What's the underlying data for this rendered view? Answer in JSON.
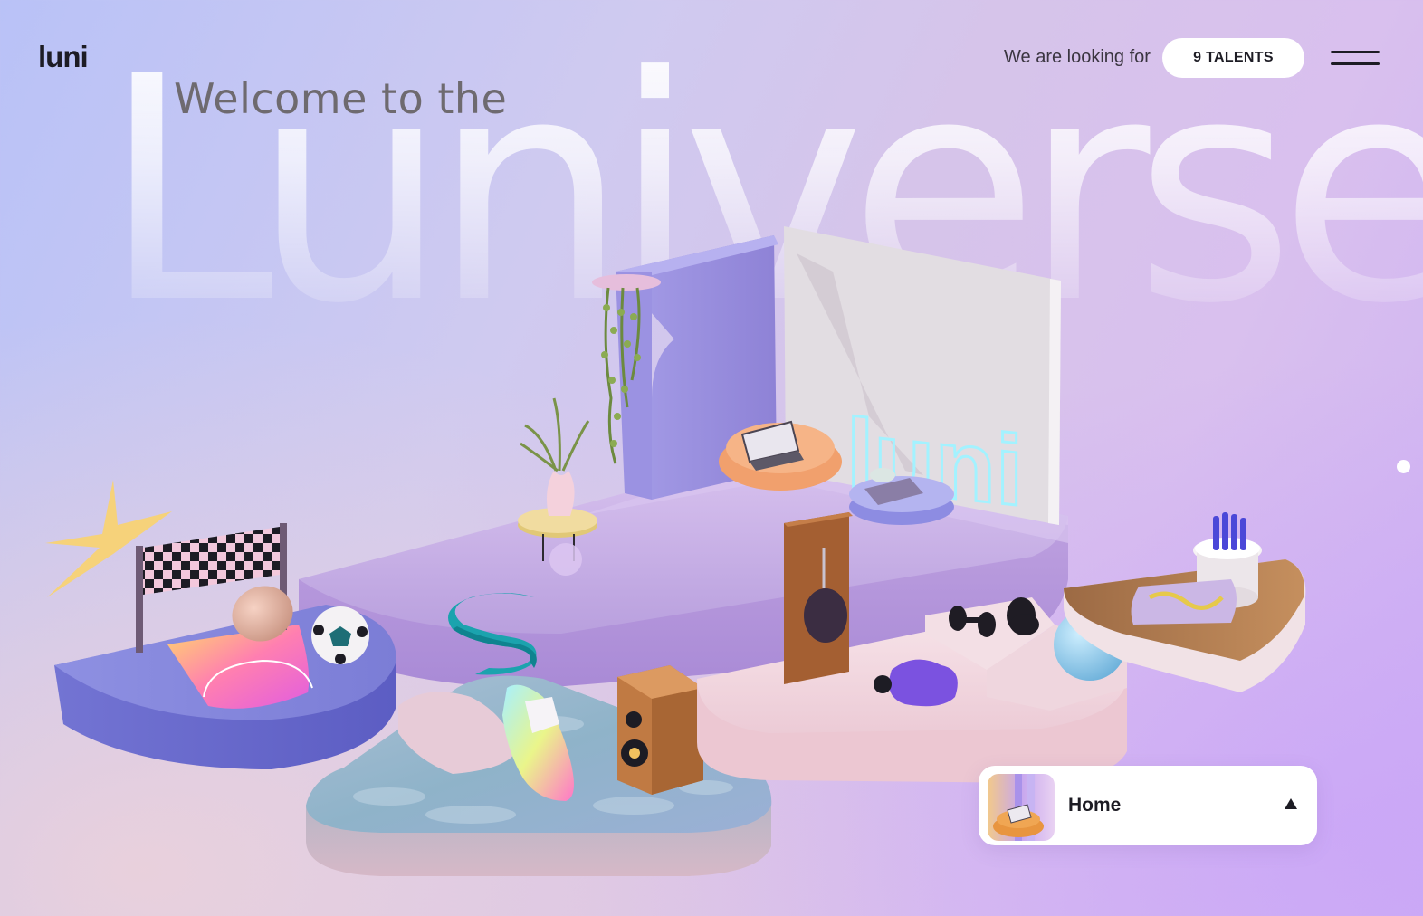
{
  "brand": {
    "logo": "luni"
  },
  "hero": {
    "welcome": "Welcome to the",
    "title": "Luniverse",
    "sign_text": "luni"
  },
  "header": {
    "looking_text": "We are looking for",
    "talents_button": "9 TALENTS",
    "menu_icon": "hamburger-menu-icon"
  },
  "nav_card": {
    "label": "Home",
    "arrow_icon": "caret-up-icon"
  },
  "colors": {
    "text_dark": "#1d1c24",
    "platform_blue": "#7f80da",
    "platform_lilac": "#c9b2e6",
    "platform_pink": "#f1d6df",
    "neon_sign": "#9ff6ff",
    "accent_orange": "#f2a06b"
  }
}
